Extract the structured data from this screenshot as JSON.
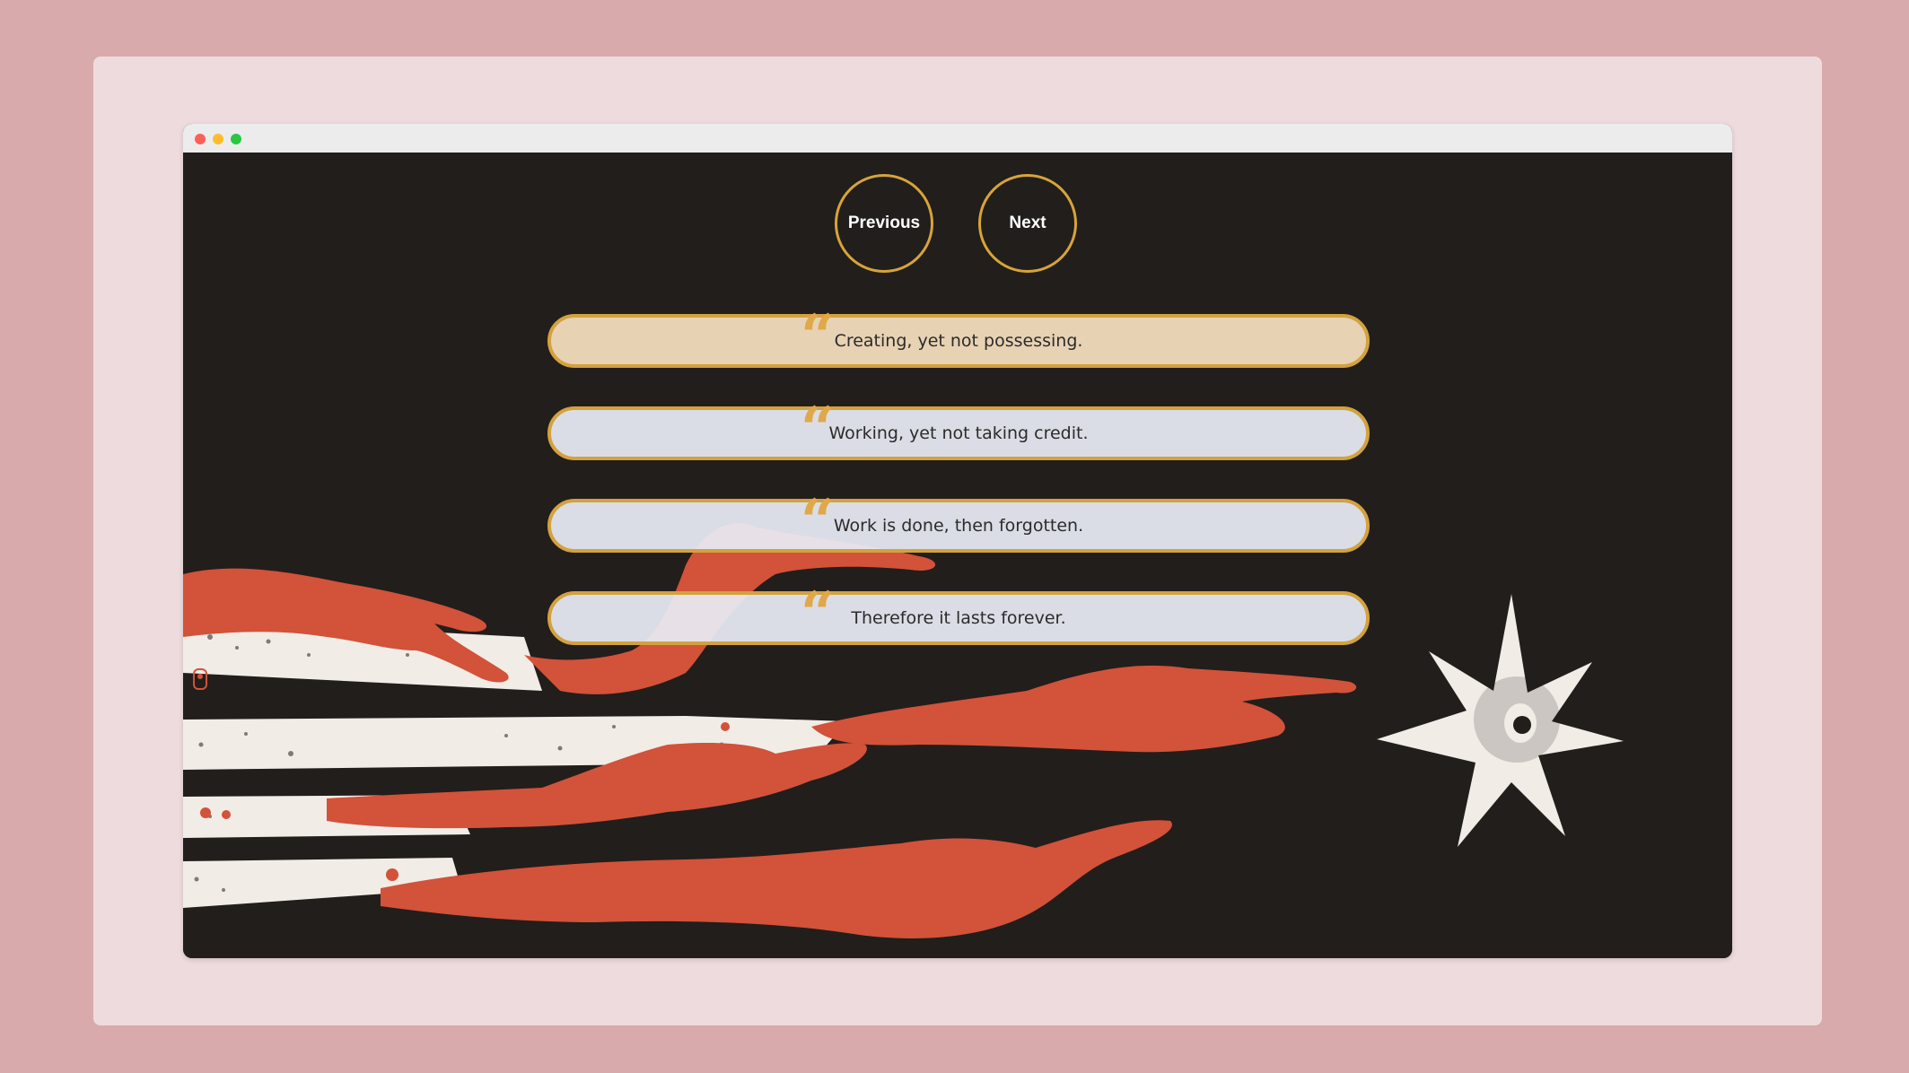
{
  "nav": {
    "previous_label": "Previous",
    "next_label": "Next"
  },
  "quotes": [
    {
      "mark": "“",
      "text": "Creating, yet not possessing."
    },
    {
      "mark": "“",
      "text": "Working, yet not taking credit."
    },
    {
      "mark": "“",
      "text": "Work is done, then forgotten."
    },
    {
      "mark": "“",
      "text": "Therefore it lasts forever."
    }
  ],
  "colors": {
    "page_background": "#d9aaab",
    "card_background": "#eedbdd",
    "stage_background": "#221e1b",
    "accent_gold": "#d3a23e",
    "hand_red": "#d2523a",
    "cream": "#f1ece6",
    "active_quote": "#e8d2b4",
    "inactive_quote": "#e8ecf4"
  },
  "icons": {
    "window_controls": [
      "close-dot",
      "minimize-dot",
      "maximize-dot"
    ],
    "quote_icon": "quote-mark-icon",
    "illustration": "reaching-hands-and-star"
  }
}
